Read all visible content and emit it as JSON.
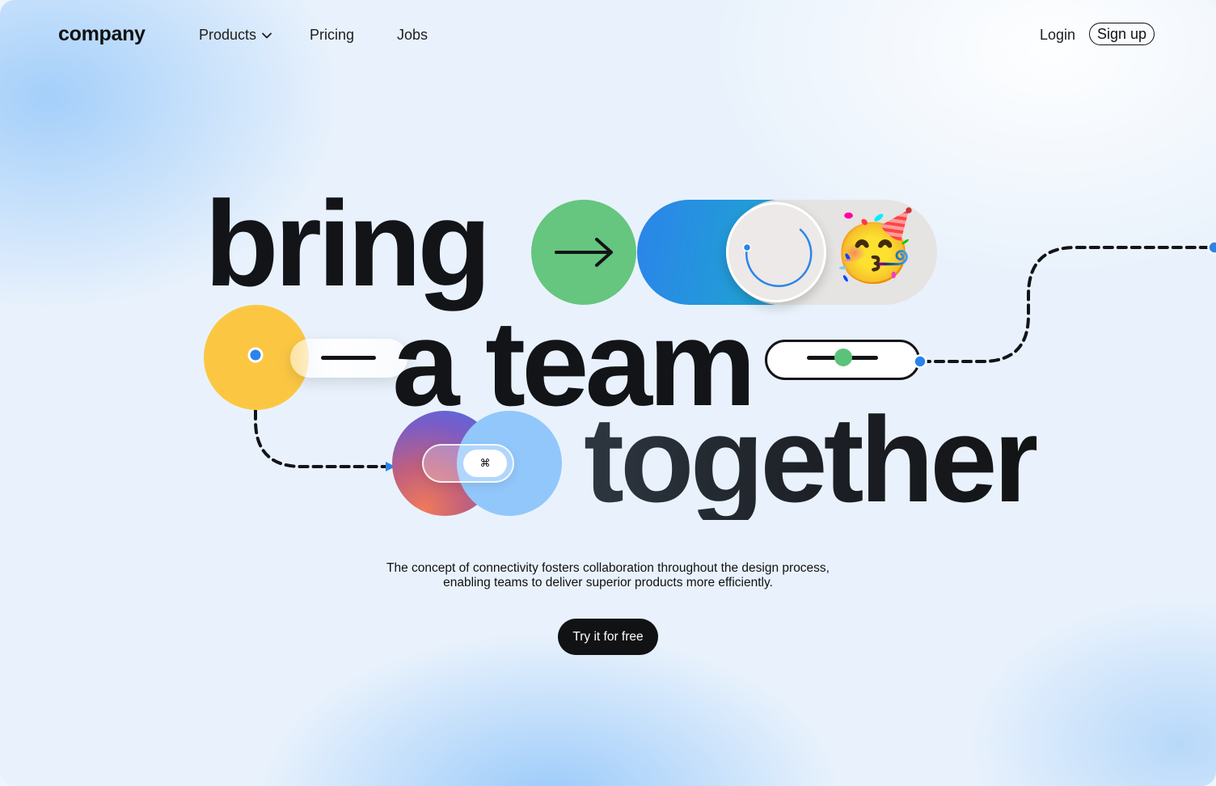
{
  "nav": {
    "logo": "company",
    "items": [
      {
        "label": "Products"
      },
      {
        "label": "Pricing"
      },
      {
        "label": "Jobs"
      }
    ],
    "login": "Login",
    "signup": "Sign up"
  },
  "hero": {
    "line1": "bring",
    "line2": "a team",
    "line3": "together",
    "cmd_key": "⌘",
    "emoji": "🥳",
    "description_line1": "The concept of connectivity fosters collaboration throughout the design process,",
    "description_line2": "enabling teams to deliver superior products more efficiently.",
    "cta": "Try it for free"
  },
  "colors": {
    "green": "#66c57e",
    "yellow": "#fbc743",
    "blue": "#2b84ea",
    "light_blue": "#92c7fb",
    "dark": "#121418"
  }
}
